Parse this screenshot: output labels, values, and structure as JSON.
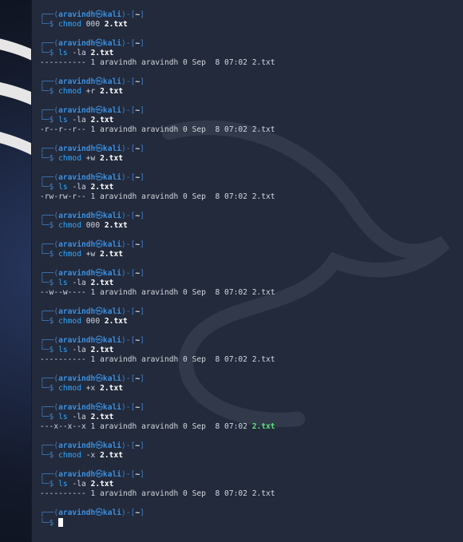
{
  "prompt": {
    "top": "┌──(",
    "user": "aravindh",
    "sep": "㉿",
    "host": "kali",
    "mid": ")-[",
    "dir": "~",
    "end": "]",
    "bottom": "└─$ "
  },
  "entries": [
    {
      "cmd": "chmod",
      "args": [
        {
          "t": "000",
          "b": false
        },
        {
          "t": "2.txt",
          "b": true
        }
      ]
    },
    {
      "cmd": "ls",
      "args": [
        {
          "t": "-la",
          "b": false
        },
        {
          "t": "2.txt",
          "b": true
        }
      ],
      "out": {
        "text": "---------- 1 aravindh aravindh 0 Sep  8 07:02 ",
        "file": "2.txt",
        "exe": false
      }
    },
    {
      "cmd": "chmod",
      "args": [
        {
          "t": "+r",
          "b": false
        },
        {
          "t": "2.txt",
          "b": true
        }
      ]
    },
    {
      "cmd": "ls",
      "args": [
        {
          "t": "-la",
          "b": false
        },
        {
          "t": "2.txt",
          "b": true
        }
      ],
      "out": {
        "text": "-r--r--r-- 1 aravindh aravindh 0 Sep  8 07:02 ",
        "file": "2.txt",
        "exe": false
      }
    },
    {
      "cmd": "chmod",
      "args": [
        {
          "t": "+w",
          "b": false
        },
        {
          "t": "2.txt",
          "b": true
        }
      ]
    },
    {
      "cmd": "ls",
      "args": [
        {
          "t": "-la",
          "b": false
        },
        {
          "t": "2.txt",
          "b": true
        }
      ],
      "out": {
        "text": "-rw-rw-r-- 1 aravindh aravindh 0 Sep  8 07:02 ",
        "file": "2.txt",
        "exe": false
      }
    },
    {
      "cmd": "chmod",
      "args": [
        {
          "t": "000",
          "b": false
        },
        {
          "t": "2.txt",
          "b": true
        }
      ]
    },
    {
      "cmd": "chmod",
      "args": [
        {
          "t": "+w",
          "b": false
        },
        {
          "t": "2.txt",
          "b": true
        }
      ]
    },
    {
      "cmd": "ls",
      "args": [
        {
          "t": "-la",
          "b": false
        },
        {
          "t": "2.txt",
          "b": true
        }
      ],
      "out": {
        "text": "--w--w---- 1 aravindh aravindh 0 Sep  8 07:02 ",
        "file": "2.txt",
        "exe": false
      }
    },
    {
      "cmd": "chmod",
      "args": [
        {
          "t": "000",
          "b": false
        },
        {
          "t": "2.txt",
          "b": true
        }
      ]
    },
    {
      "cmd": "ls",
      "args": [
        {
          "t": "-la",
          "b": false
        },
        {
          "t": "2.txt",
          "b": true
        }
      ],
      "out": {
        "text": "---------- 1 aravindh aravindh 0 Sep  8 07:02 ",
        "file": "2.txt",
        "exe": false
      }
    },
    {
      "cmd": "chmod",
      "args": [
        {
          "t": "+x",
          "b": false
        },
        {
          "t": "2.txt",
          "b": true
        }
      ]
    },
    {
      "cmd": "ls",
      "args": [
        {
          "t": "-la",
          "b": false
        },
        {
          "t": "2.txt",
          "b": true
        }
      ],
      "out": {
        "text": "---x--x--x 1 aravindh aravindh 0 Sep  8 07:02 ",
        "file": "2.txt",
        "exe": true
      }
    },
    {
      "cmd": "chmod",
      "args": [
        {
          "t": "-x",
          "b": false
        },
        {
          "t": "2.txt",
          "b": true
        }
      ]
    },
    {
      "cmd": "ls",
      "args": [
        {
          "t": "-la",
          "b": false
        },
        {
          "t": "2.txt",
          "b": true
        }
      ],
      "out": {
        "text": "---------- 1 aravindh aravindh 0 Sep  8 07:02 ",
        "file": "2.txt",
        "exe": false
      }
    },
    {
      "cmd": "",
      "args": [],
      "cursor": true
    }
  ],
  "colors": {
    "terminal_bg": "#232a3b",
    "prompt_blue": "#3a8fe0",
    "exec_green": "#5fe07c"
  }
}
